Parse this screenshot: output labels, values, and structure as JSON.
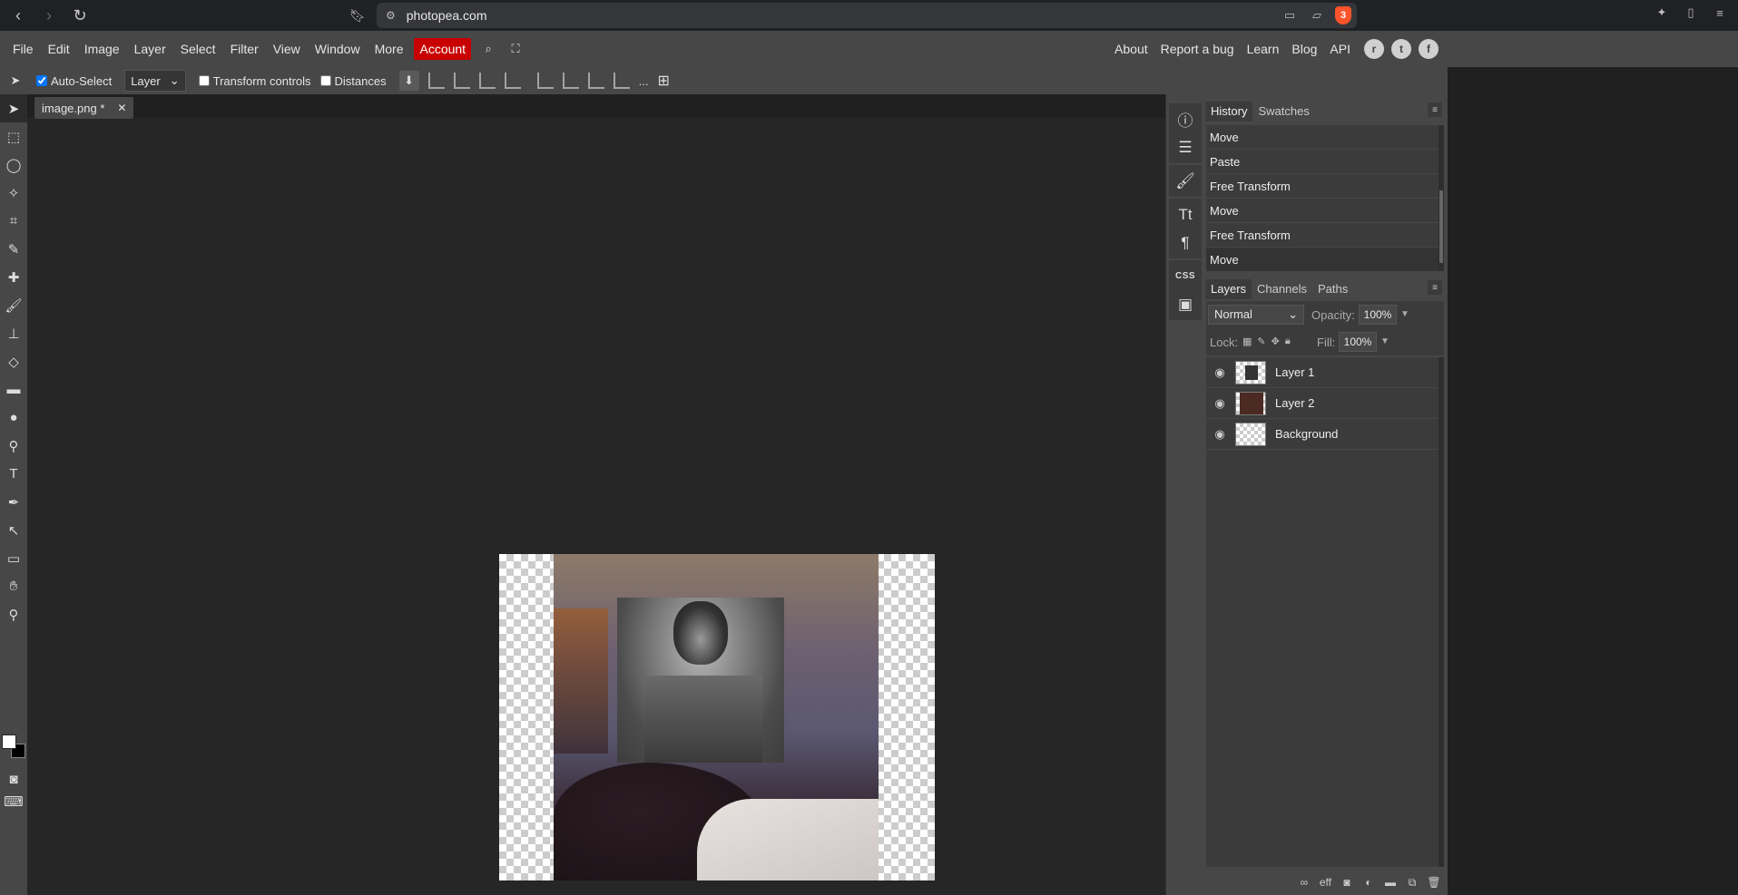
{
  "browser": {
    "url": "photopea.com",
    "brave_badge": "3"
  },
  "menu": {
    "items": [
      "File",
      "Edit",
      "Image",
      "Layer",
      "Select",
      "Filter",
      "View",
      "Window",
      "More"
    ],
    "account": "Account",
    "right_links": [
      "About",
      "Report a bug",
      "Learn",
      "Blog",
      "API"
    ]
  },
  "options": {
    "auto_select_label": "Auto-Select",
    "auto_select_checked": true,
    "target": "Layer",
    "transform_controls_label": "Transform controls",
    "distances_label": "Distances",
    "more": "..."
  },
  "document": {
    "tab_title": "image.png *",
    "close": "✕"
  },
  "history_panel": {
    "tabs": [
      "History",
      "Swatches"
    ],
    "items": [
      "Move",
      "Paste",
      "Free Transform",
      "Move",
      "Free Transform",
      "Move"
    ]
  },
  "layers_panel": {
    "tabs": [
      "Layers",
      "Channels",
      "Paths"
    ],
    "blend_mode": "Normal",
    "opacity_label": "Opacity:",
    "opacity": "100%",
    "lock_label": "Lock:",
    "fill_label": "Fill:",
    "fill": "100%",
    "layers": [
      {
        "name": "Layer 1"
      },
      {
        "name": "Layer 2"
      },
      {
        "name": "Background"
      }
    ],
    "footer_eff": "eff"
  },
  "mini": {
    "css_label": "CSS"
  },
  "colors": {
    "account_bg": "#c80000",
    "panel_bg": "#474747",
    "workspace_bg": "#262626"
  }
}
